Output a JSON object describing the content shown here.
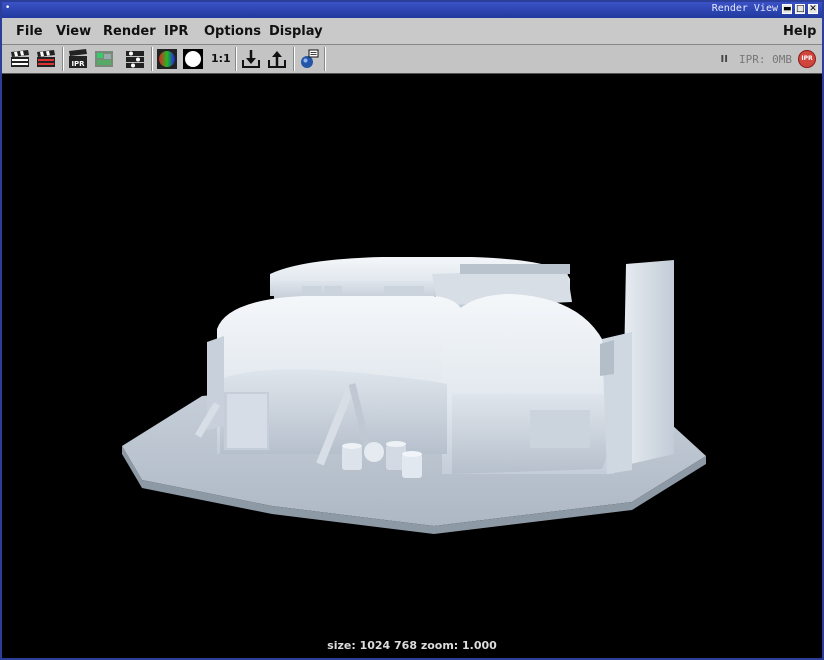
{
  "window": {
    "title": "Render View",
    "minimize": "▬",
    "maximize": "□",
    "close": "✕"
  },
  "menu": [
    "File",
    "View",
    "Render",
    "IPR",
    "Options",
    "Display"
  ],
  "menu_help": "Help",
  "toolbar": {
    "ratio_label": "1:1",
    "pause_label": "II",
    "ipr_memory": "IPR: 0MB",
    "ipr_stop_label": "IPR",
    "ipr_icon_label": "IPR"
  },
  "icons": {
    "redo": "clapper-icon",
    "render_region": "render-region-icon",
    "ipr_render": "ipr-render-icon",
    "snapshot": "snapshot-icon",
    "render_settings": "render-settings-icon",
    "rgb": "rgb-channels-icon",
    "alpha": "alpha-channel-icon",
    "keep": "keep-image-icon",
    "remove": "remove-image-icon",
    "render_globals": "render-globals-icon"
  },
  "render_info": "size: 1024  768 zoom: 1.000",
  "colors": {
    "titlebar": "#2a3e9a",
    "menubar": "#c9c9c9",
    "toolbar": "#c4c4c4",
    "viewport_bg": "#000000",
    "model": "#dfe6ee"
  }
}
